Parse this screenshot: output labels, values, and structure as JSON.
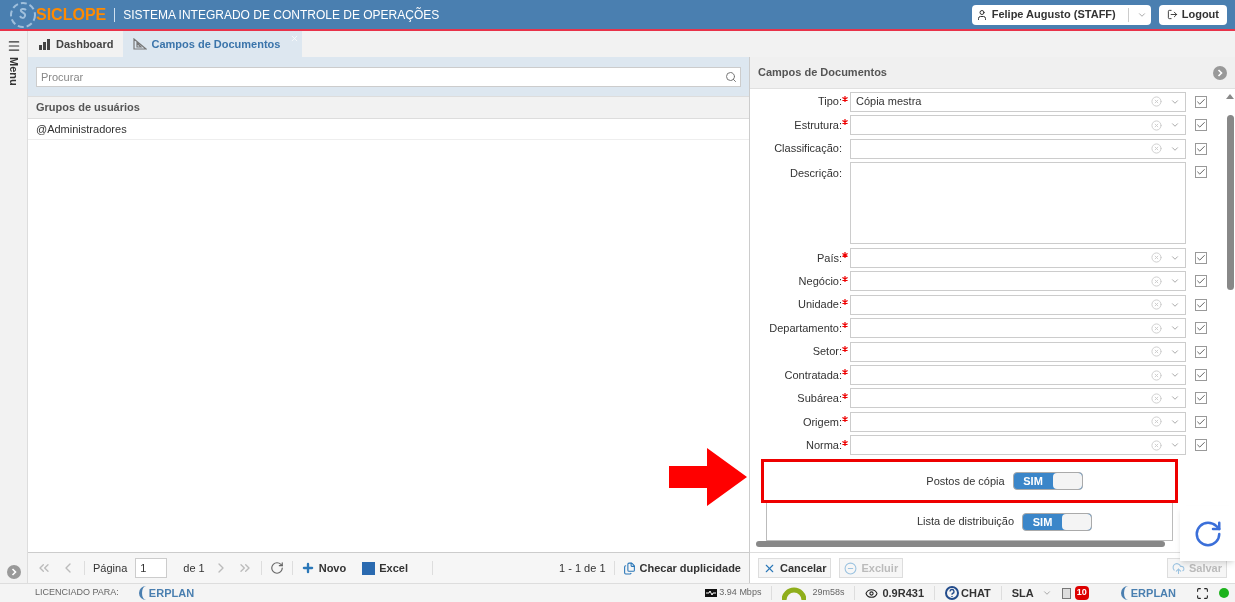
{
  "header": {
    "logo": "SICLOPE",
    "title": "SISTEMA INTEGRADO DE CONTROLE DE OPERAÇÕES",
    "user": "Felipe Augusto (STAFF)",
    "logout": "Logout"
  },
  "sidebar": {
    "label": "Menu"
  },
  "tabs": [
    {
      "label": "Dashboard",
      "selected": false,
      "closable": false
    },
    {
      "label": "Campos de Documentos",
      "selected": true,
      "closable": true
    }
  ],
  "list": {
    "search_placeholder": "Procurar",
    "column": "Grupos de usuários",
    "rows": [
      {
        "text": "@Administradores",
        "selected": false
      }
    ]
  },
  "pager": {
    "page_label": "Página",
    "page": "1",
    "of": "de 1",
    "new": "Novo",
    "excel": "Excel",
    "count": "1 - 1 de 1",
    "check": "Checar duplicidade"
  },
  "form": {
    "title": "Campos de Documentos",
    "fields": [
      {
        "label": "Tipo:",
        "required": true,
        "value": "Cópia mestra",
        "kind": "select",
        "checked": true
      },
      {
        "label": "Estrutura:",
        "required": true,
        "kind": "select",
        "checked": true
      },
      {
        "label": "Classificação:",
        "required": false,
        "kind": "select",
        "checked": true
      },
      {
        "label": "Descrição:",
        "required": false,
        "kind": "textarea",
        "checked": true
      },
      {
        "label": "País:",
        "required": true,
        "kind": "select",
        "checked": true
      },
      {
        "label": "Negócio:",
        "required": true,
        "kind": "select",
        "checked": true
      },
      {
        "label": "Unidade:",
        "required": true,
        "kind": "select",
        "checked": true
      },
      {
        "label": "Departamento:",
        "required": true,
        "kind": "select",
        "checked": true
      },
      {
        "label": "Setor:",
        "required": true,
        "kind": "select",
        "checked": true
      },
      {
        "label": "Contratada:",
        "required": true,
        "kind": "select",
        "checked": true
      },
      {
        "label": "Subárea:",
        "required": true,
        "kind": "select",
        "checked": true
      },
      {
        "label": "Origem:",
        "required": true,
        "kind": "select",
        "checked": true
      },
      {
        "label": "Norma:",
        "required": true,
        "kind": "select",
        "checked": true
      }
    ],
    "toggles": [
      {
        "label": "Postos de cópia",
        "on": true,
        "on_text": "SIM",
        "highlighted": true
      },
      {
        "label": "Lista de distribuição",
        "on": true,
        "on_text": "SIM",
        "highlighted": false
      }
    ],
    "buttons": [
      {
        "label": "Cancelar",
        "kind": "cancel",
        "disabled": false
      },
      {
        "label": "Excluir",
        "kind": "delete",
        "disabled": true
      },
      {
        "label": "Salvar",
        "kind": "save",
        "disabled": true
      }
    ]
  },
  "status": {
    "licensed": "LICENCIADO PARA:",
    "brand_left": "ERPLAN",
    "speed": "3.94 Mbps",
    "timer": "29m58s",
    "version": "0.9R431",
    "chat": "CHAT",
    "sla": "SLA",
    "notifications": "10",
    "brand_right": "ERPLAN",
    "online": true
  }
}
